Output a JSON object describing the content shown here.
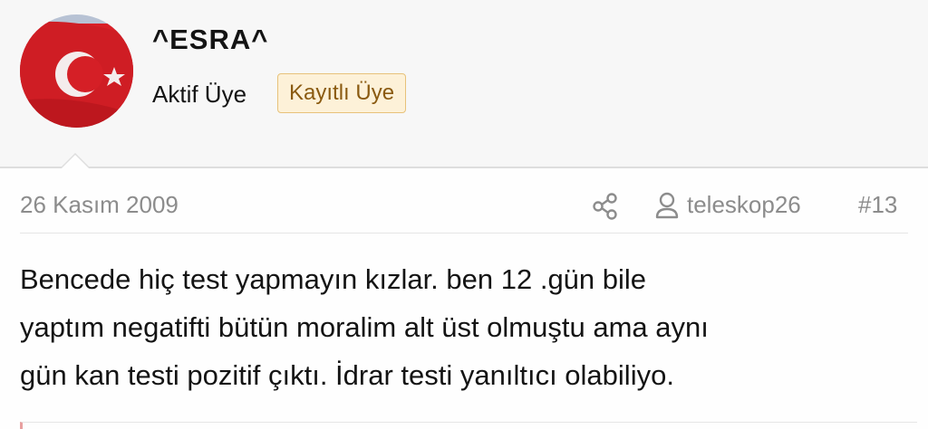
{
  "user": {
    "name": "^ESRA^",
    "title": "Aktif Üye",
    "badge": "Kayıtlı Üye",
    "avatar_icon": "turkish-flag-avatar"
  },
  "post": {
    "date": "26 Kasım 2009",
    "share_icon": "share-icon",
    "user_icon": "user-icon",
    "author_link": "teleskop26",
    "number": "#13",
    "lines": [
      "Bencede hiç test yapmayın kızlar. ben 12 .gün bile",
      "yaptım negatifti bütün moralim alt üst olmuştu ama aynı",
      "gün kan testi pozitif çıktı. İdrar testi yanıltıcı olabiliyo."
    ]
  },
  "colors": {
    "badge_bg": "#fdf1d8",
    "badge_border": "#e7c27a",
    "badge_text": "#8a5a10",
    "meta_text": "#8c8c8c",
    "flag_red": "#d92027"
  }
}
